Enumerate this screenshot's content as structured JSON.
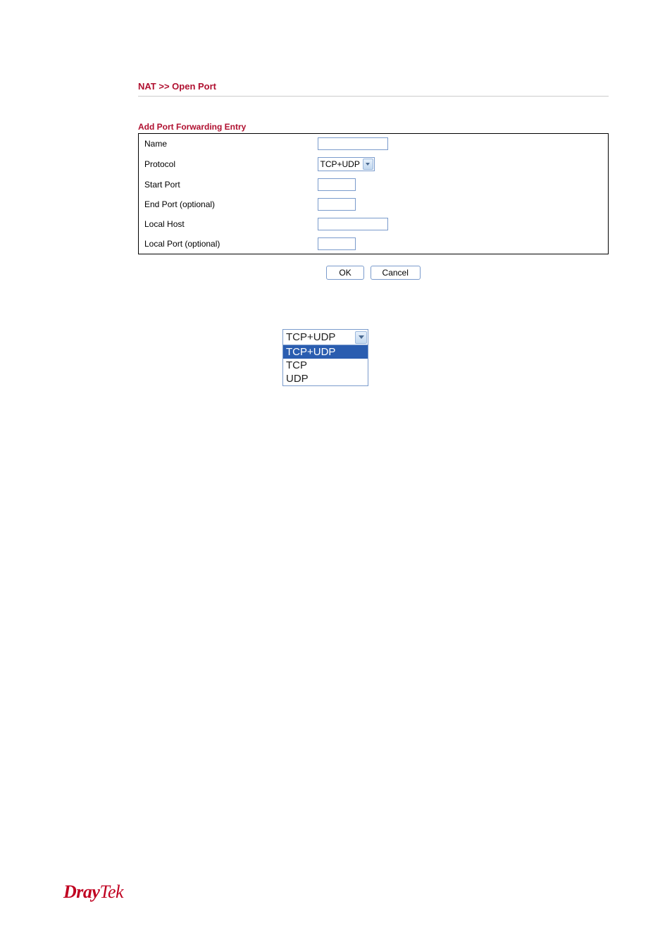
{
  "breadcrumb": "NAT >> Open Port",
  "section_title": "Add Port Forwarding Entry",
  "form": {
    "name_label": "Name",
    "protocol_label": "Protocol",
    "protocol_selected": "TCP+UDP",
    "start_port_label": "Start Port",
    "end_port_label": "End Port (optional)",
    "local_host_label": "Local Host",
    "local_port_label": "Local Port (optional)"
  },
  "buttons": {
    "ok": "OK",
    "cancel": "Cancel"
  },
  "dropdown": {
    "current": "TCP+UDP",
    "options": [
      "TCP+UDP",
      "TCP",
      "UDP"
    ],
    "selected_index": 0
  },
  "footer": {
    "brand_bold": "Dray",
    "brand_light": "Tek"
  }
}
